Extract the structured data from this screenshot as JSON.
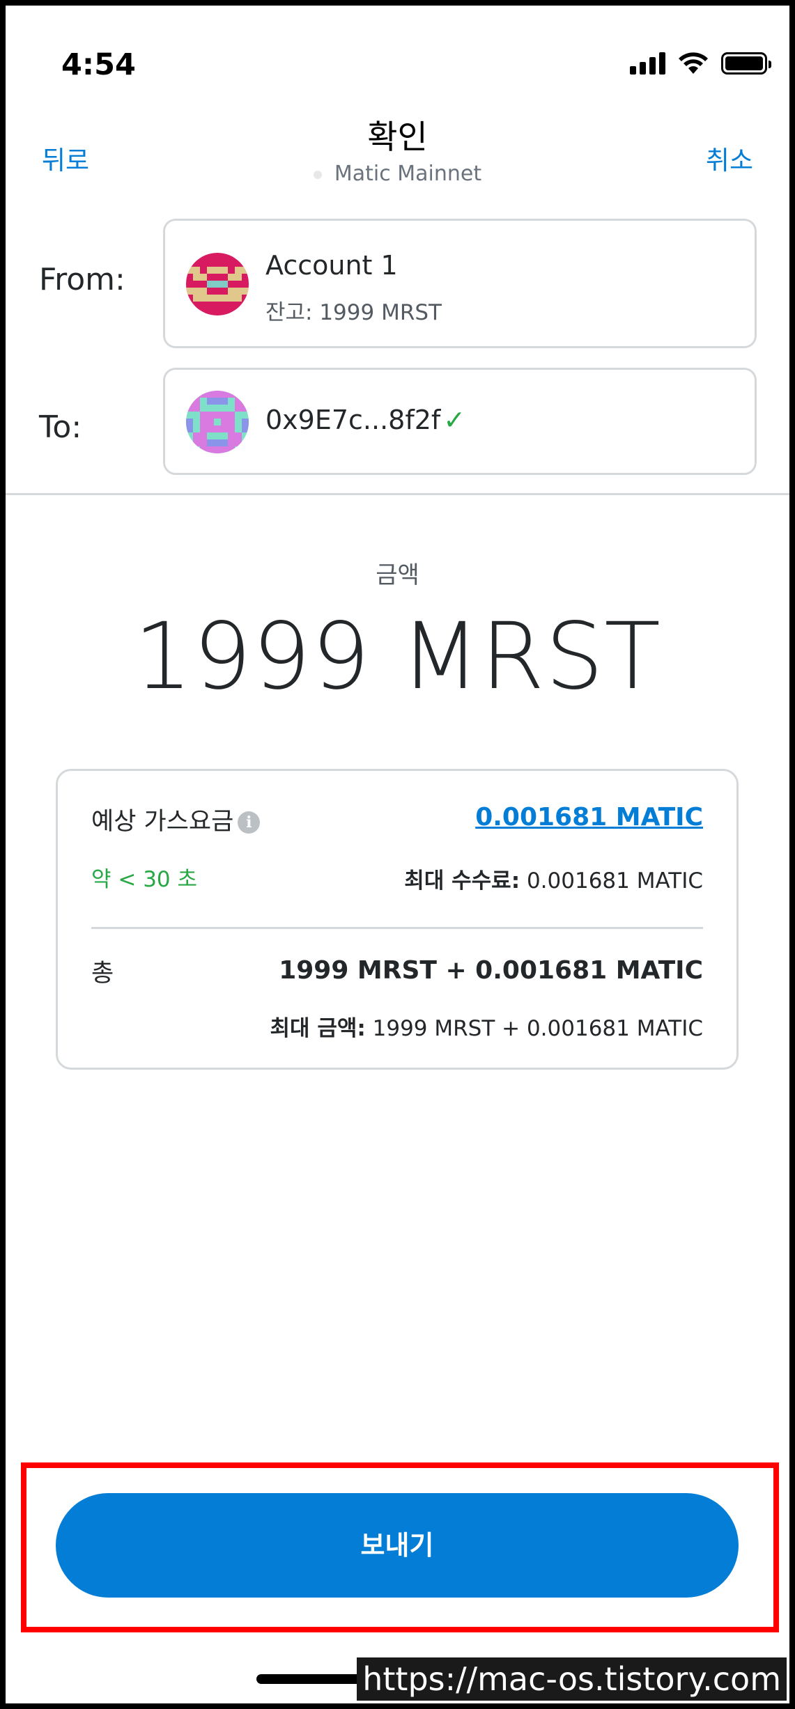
{
  "status_bar": {
    "time": "4:54"
  },
  "header": {
    "back_label": "뒤로",
    "title": "확인",
    "network": "Matic Mainnet",
    "cancel_label": "취소"
  },
  "from": {
    "label": "From:",
    "account_name": "Account 1",
    "balance": "잔고: 1999 MRST"
  },
  "to": {
    "label": "To:",
    "address": "0x9E7c...8f2f",
    "verified_icon": "check-icon"
  },
  "amount": {
    "label": "금액",
    "value": "1999 MRST"
  },
  "gas": {
    "title": "예상 가스요금",
    "fee": "0.001681 MATIC",
    "time_estimate": "약 < 30 초",
    "max_fee_label": "최대 수수료:",
    "max_fee_value": " 0.001681 MATIC",
    "total_label": "총",
    "total_value": "1999 MRST + 0.001681 MATIC",
    "max_amount_label": "최대 금액:",
    "max_amount_value": " 1999 MRST + 0.001681 MATIC"
  },
  "send_button": {
    "label": "보내기"
  },
  "watermark": "https://mac-os.tistory.com",
  "colors": {
    "accent": "#037dd6",
    "success": "#28a745",
    "highlight": "#ff0000"
  }
}
